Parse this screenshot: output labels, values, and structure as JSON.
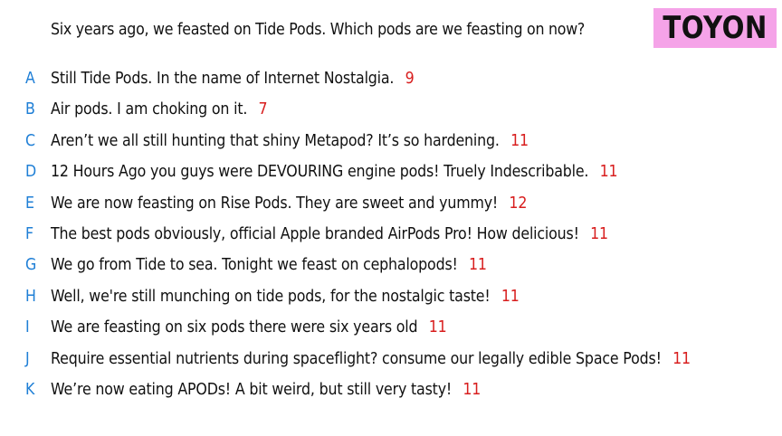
{
  "question": "Six years ago, we feasted on Tide Pods. Which pods are we feasting on now?",
  "badge": {
    "text": "TOYON",
    "color": "#f5a3e8"
  },
  "colors": {
    "letter": "#1f7fd6",
    "score": "#d81e1e"
  },
  "answers": [
    {
      "letter": "A",
      "text": "Still Tide Pods. In the name of Internet Nostalgia.",
      "score": "9"
    },
    {
      "letter": "B",
      "text": "Air pods. I am choking on it.",
      "score": "7"
    },
    {
      "letter": "C",
      "text": "Aren’t we all still hunting that shiny Metapod? It’s so hardening.",
      "score": "11"
    },
    {
      "letter": "D",
      "text": "12 Hours Ago you guys were DEVOURING engine pods! Truely Indescribable.",
      "score": "11"
    },
    {
      "letter": "E",
      "text": "We are now feasting on Rise Pods. They are sweet and yummy!",
      "score": "12"
    },
    {
      "letter": "F",
      "text": "The best pods obviously, official Apple branded AirPods Pro! How delicious!",
      "score": "11"
    },
    {
      "letter": "G",
      "text": "We go from Tide to sea. Tonight we feast on cephalopods!",
      "score": "11"
    },
    {
      "letter": "H",
      "text": "Well, we're still munching on tide pods, for the nostalgic taste!",
      "score": "11"
    },
    {
      "letter": "I",
      "text": "We are feasting on six pods there were six years old",
      "score": "11"
    },
    {
      "letter": "J",
      "text": "Require essential nutrients during spaceflight? consume our legally edible Space Pods!",
      "score": "11"
    },
    {
      "letter": "K",
      "text": "We’re now eating APODs! A bit weird, but still very tasty!",
      "score": "11"
    }
  ]
}
